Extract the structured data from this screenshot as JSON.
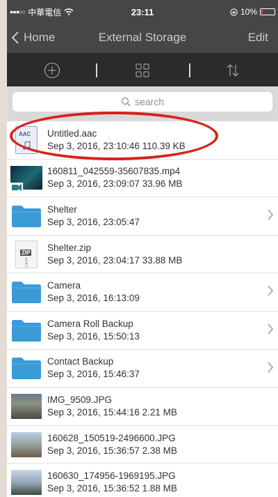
{
  "status": {
    "carrier": "中華電信",
    "time": "23:11",
    "battery": "10%",
    "battery_level": 0.1,
    "colors": {
      "battery_low": "#ff3b30"
    }
  },
  "nav": {
    "back_label": "Home",
    "title": "External Storage",
    "edit_label": "Edit"
  },
  "toolbar": {
    "add_icon": "plus-circle-icon",
    "grid_icon": "grid-icon",
    "sort_icon": "sort-arrows-icon"
  },
  "search": {
    "placeholder": "search"
  },
  "files": [
    {
      "name": "Untitled.aac",
      "meta": "Sep 3, 2016, 23:10:46  110.39 KB",
      "kind": "aac",
      "icon": "aac-file-icon"
    },
    {
      "name": "160811_042559-35607835.mp4",
      "meta": "Sep 3, 2016, 23:09:07  33.96 MB",
      "kind": "video",
      "icon": "video-thumbnail"
    },
    {
      "name": "Shelter",
      "meta": "Sep 3, 2016, 23:05:47",
      "kind": "folder",
      "icon": "folder-icon"
    },
    {
      "name": "Shelter.zip",
      "meta": "Sep 3, 2016, 23:04:17  33.88 MB",
      "kind": "zip",
      "icon": "zip-file-icon"
    },
    {
      "name": "Camera",
      "meta": "Sep 3, 2016, 16:13:09",
      "kind": "folder",
      "icon": "folder-icon"
    },
    {
      "name": "Camera Roll Backup",
      "meta": "Sep 3, 2016, 15:50:13",
      "kind": "folder",
      "icon": "folder-icon"
    },
    {
      "name": "Contact Backup",
      "meta": "Sep 3, 2016, 15:46:37",
      "kind": "folder",
      "icon": "folder-icon"
    },
    {
      "name": "IMG_9509.JPG",
      "meta": "Sep 3, 2016, 15:44:16  2.21 MB",
      "kind": "photo",
      "icon": "photo-thumbnail"
    },
    {
      "name": "160628_150519-2496600.JPG",
      "meta": "Sep 3, 2016, 15:36:57  2.38 MB",
      "kind": "photo",
      "icon": "photo-thumbnail"
    },
    {
      "name": "160630_174956-1969195.JPG",
      "meta": "Sep 3, 2016, 15:36:52  1.88 MB",
      "kind": "photo",
      "icon": "photo-thumbnail"
    }
  ],
  "colors": {
    "header": "#464646",
    "toolbar": "#2b2b2b",
    "folder": "#3a9ad6",
    "annotation": "#d8221b"
  }
}
